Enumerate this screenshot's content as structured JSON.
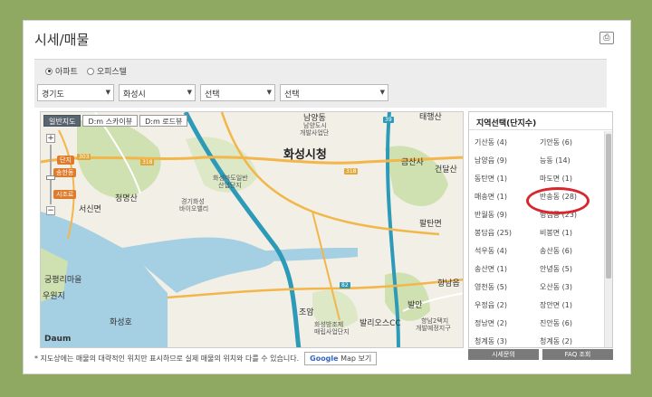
{
  "title": "시세/매물",
  "radios": [
    {
      "label": "아파트",
      "checked": true
    },
    {
      "label": "오피스텔",
      "checked": false
    }
  ],
  "selects": [
    {
      "value": "경기도"
    },
    {
      "value": "화성시"
    },
    {
      "value": "선택"
    },
    {
      "value": "선택"
    }
  ],
  "map": {
    "tabs": [
      "일반지도",
      "D:m 스카이뷰",
      "D:m 로드뷰"
    ],
    "labels": {
      "city_hall": "화성시청",
      "namyang": "남양동",
      "namyang_office": "남양도시",
      "namyang_office2": "개발사업단",
      "songsan": "송산면",
      "hwaseong_station": "화성마도일반",
      "hwaseong_station2": "산업단지",
      "gyeonggi": "경기화성",
      "gyeonggi2": "바이오밸리",
      "cheongmyeongsan": "청명산",
      "seosin": "서신면",
      "gungpyeong": "궁평리마을",
      "uwonji": "우원지",
      "hwaseongho": "화성호",
      "jiwon": "지원",
      "daedosan": "태행산",
      "geumsa": "금산사",
      "geondalsan": "건달산",
      "paltanmyeon": "팔탄면",
      "bukjeong": "북정",
      "jangan": "조암",
      "golf": "발리오스CC",
      "balan": "발안",
      "hyangnam": "향남읍",
      "hyangnam2": "향남2택지",
      "hyangnam3": "개발예정지구",
      "hwaseonghyeon": "화성방조제",
      "hwaseonghyeon2": "매립사업단지"
    },
    "badges": {
      "danji": "단지",
      "hwaseongdang": "송한동",
      "sijaro": "시조로"
    },
    "roads": {
      "r1": "303",
      "r2": "318",
      "r3": "318",
      "r4": "39",
      "r5": "82"
    },
    "logo": "Daum"
  },
  "notice": "* 지도상에는 매물의 대략적인 위치만 표시하므로 실제 매물의 위치와 다를 수 있습니다.",
  "google_btn": {
    "brand": "Google",
    "text": " Map 보기"
  },
  "region": {
    "header": "지역선택(단지수)",
    "items": [
      "기산동 (4)",
      "기안동 (6)",
      "남양읍 (9)",
      "능동 (14)",
      "동탄면 (1)",
      "마도면 (1)",
      "매송면 (1)",
      "반송동 (28)",
      "반월동 (9)",
      "병점동 (23)",
      "봉담읍 (25)",
      "비봉면 (1)",
      "석우동 (4)",
      "송산동 (6)",
      "송산면 (1)",
      "안녕동 (5)",
      "영천동 (5)",
      "오산동 (3)",
      "우정읍 (2)",
      "장안면 (1)",
      "정남면 (2)",
      "진안동 (6)",
      "청계동 (3)",
      "청계동 (2)"
    ]
  },
  "bottom_btns": [
    "시세문의",
    "FAQ 조회"
  ],
  "colors": {
    "background": "#8fa862",
    "highlight_circle": "#d7262e",
    "highway": "#2d9ab8",
    "road": "#f2b64a",
    "water": "#a5cfe3",
    "forest": "#cfe1b0"
  }
}
